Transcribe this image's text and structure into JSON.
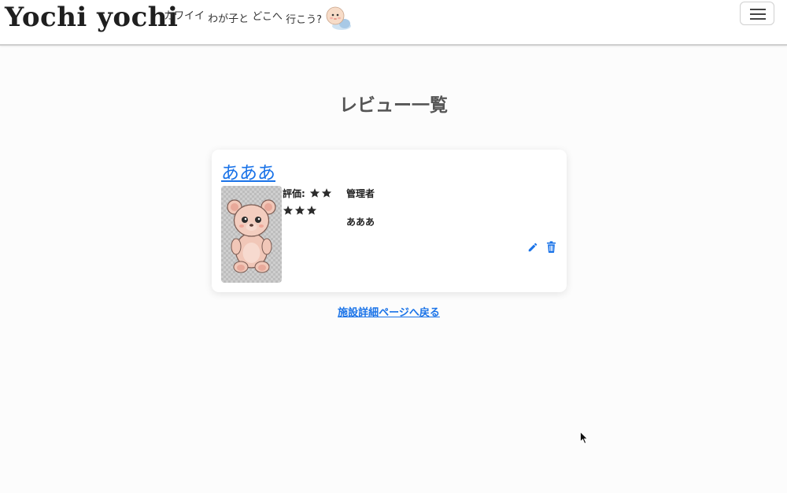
{
  "header": {
    "brand": "Yochi yochi",
    "tagline": [
      "カワイイ",
      "わが子と",
      "どこへ",
      "行こう?"
    ],
    "baby_icon": "baby-icon",
    "menu_icon": "hamburger-menu-icon"
  },
  "page": {
    "title": "レビュー一覧"
  },
  "review": {
    "title": "あああ",
    "rating_label": "評価:",
    "rating_first_row_stars": 2,
    "rating_second_row_stars": 3,
    "author": "管理者",
    "comment": "あああ",
    "image": "teddy-bear-image",
    "edit_icon": "pencil-icon",
    "delete_icon": "trash-icon"
  },
  "back_link": "施設詳細ページへ戻る",
  "colors": {
    "link": "#1a73e8",
    "background": "#fcfcfc",
    "text": "#333333"
  }
}
